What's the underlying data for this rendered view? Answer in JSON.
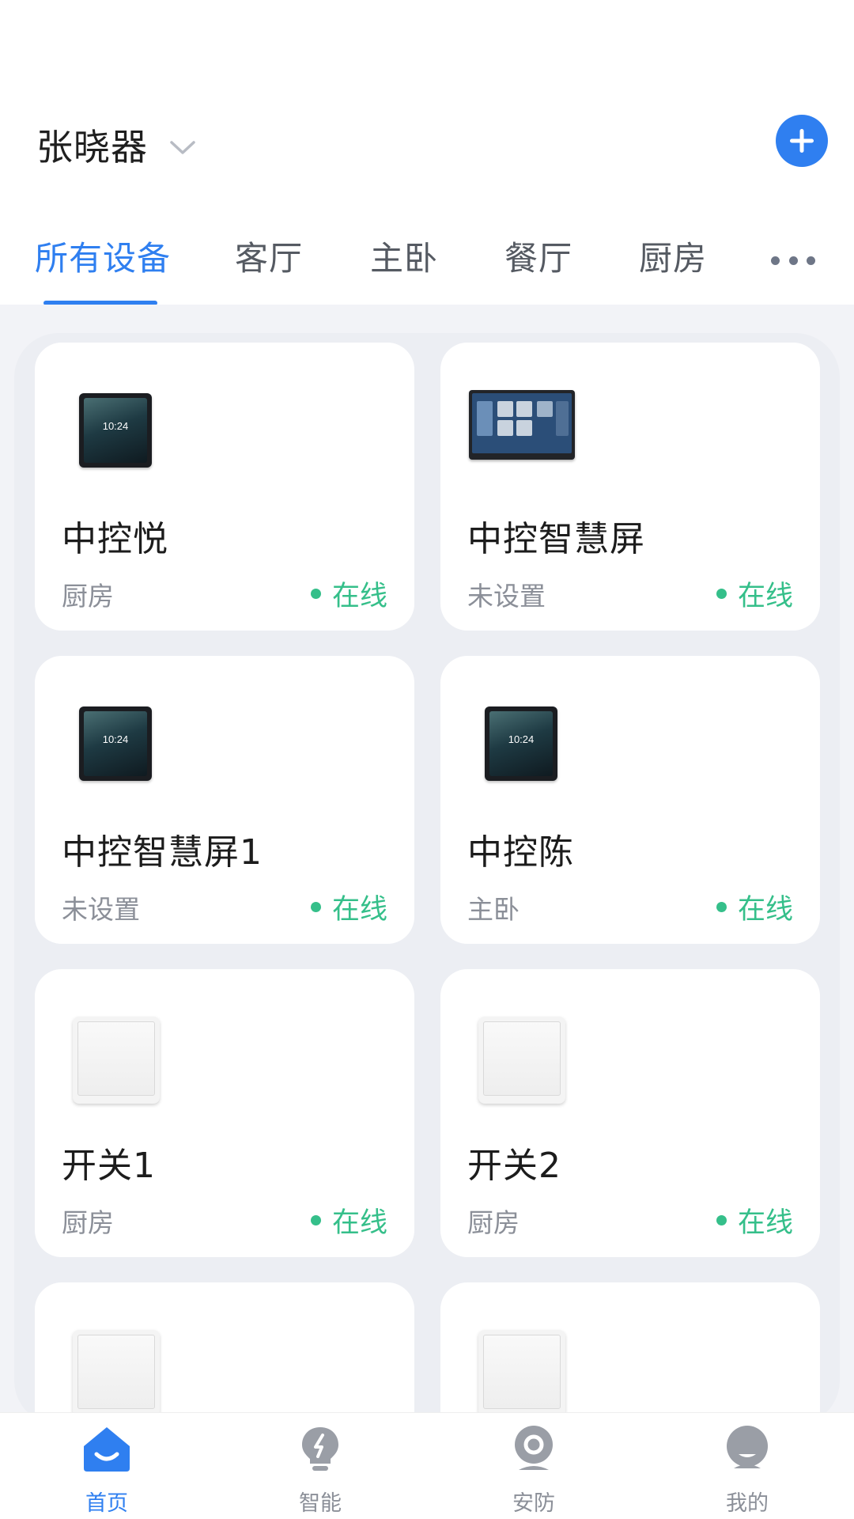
{
  "header": {
    "home_name": "张晓器",
    "chevron_icon": "chevron-down-icon",
    "add_icon": "plus-icon",
    "accent_color": "#2f7ff0"
  },
  "tabs": [
    {
      "label": "所有设备",
      "active": true
    },
    {
      "label": "客厅",
      "active": false
    },
    {
      "label": "主卧",
      "active": false
    },
    {
      "label": "餐厅",
      "active": false
    },
    {
      "label": "厨房",
      "active": false
    }
  ],
  "more_icon": "more-horizontal-icon",
  "devices": [
    {
      "name": "中控悦",
      "room": "厨房",
      "status": "在线",
      "image": "control-panel-small"
    },
    {
      "name": "中控智慧屏",
      "room": "未设置",
      "status": "在线",
      "image": "control-panel-wide"
    },
    {
      "name": "中控智慧屏1",
      "room": "未设置",
      "status": "在线",
      "image": "control-panel-small"
    },
    {
      "name": "中控陈",
      "room": "主卧",
      "status": "在线",
      "image": "control-panel-small"
    },
    {
      "name": "开关1",
      "room": "厨房",
      "status": "在线",
      "image": "wall-switch"
    },
    {
      "name": "开关2",
      "room": "厨房",
      "status": "在线",
      "image": "wall-switch"
    },
    {
      "image": "wall-switch"
    },
    {
      "image": "wall-switch"
    }
  ],
  "panel_clock": "10:24",
  "status_color": "#35bf8a",
  "bottom_nav": [
    {
      "label": "首页",
      "icon": "home-icon",
      "active": true
    },
    {
      "label": "智能",
      "icon": "bulb-icon",
      "active": false
    },
    {
      "label": "安防",
      "icon": "camera-icon",
      "active": false
    },
    {
      "label": "我的",
      "icon": "user-icon",
      "active": false
    }
  ]
}
